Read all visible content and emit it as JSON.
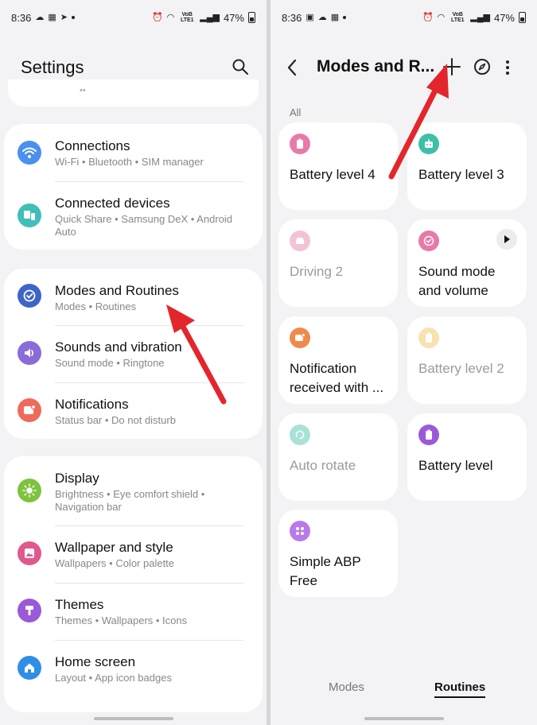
{
  "left": {
    "status": {
      "time": "8:36",
      "battery": "47%",
      "network": "VoB LTE1"
    },
    "title": "Settings",
    "groups": [
      {
        "items": [
          {
            "title": "Connections",
            "subtitle": "Wi-Fi  •  Bluetooth  •  SIM manager",
            "icon": "wifi-icon",
            "color": "#4a90f0"
          },
          {
            "title": "Connected devices",
            "subtitle": "Quick Share  •  Samsung DeX  •  Android Auto",
            "icon": "devices-icon",
            "color": "#3fbfb8"
          }
        ]
      },
      {
        "items": [
          {
            "title": "Modes and Routines",
            "subtitle": "Modes  •  Routines",
            "icon": "check-circle-icon",
            "color": "#3f64c8"
          },
          {
            "title": "Sounds and vibration",
            "subtitle": "Sound mode  •  Ringtone",
            "icon": "speaker-icon",
            "color": "#8a6cd8"
          },
          {
            "title": "Notifications",
            "subtitle": "Status bar  •  Do not disturb",
            "icon": "notification-icon",
            "color": "#ef6a5a"
          }
        ]
      },
      {
        "items": [
          {
            "title": "Display",
            "subtitle": "Brightness  •  Eye comfort shield  •  Navigation bar",
            "icon": "sun-icon",
            "color": "#7cc43c"
          },
          {
            "title": "Wallpaper and style",
            "subtitle": "Wallpapers  •  Color palette",
            "icon": "image-icon",
            "color": "#e0588e"
          },
          {
            "title": "Themes",
            "subtitle": "Themes  •  Wallpapers  •  Icons",
            "icon": "brush-icon",
            "color": "#9a5ad8"
          },
          {
            "title": "Home screen",
            "subtitle": "Layout  •  App icon badges",
            "icon": "home-icon",
            "color": "#2f8ee8"
          }
        ]
      }
    ]
  },
  "right": {
    "status": {
      "time": "8:36",
      "battery": "47%",
      "network": "VoB LTE1"
    },
    "title": "Modes and R...",
    "section_label": "All",
    "tiles": [
      {
        "label": "Battery level 4",
        "icon": "battery-icon",
        "color": "#e77aa8",
        "dim": false
      },
      {
        "label": "Battery level 3",
        "icon": "robot-icon",
        "color": "#3fbfa8",
        "dim": false
      },
      {
        "label": "Driving 2",
        "icon": "car-icon",
        "color": "#e77aa8",
        "dim": true
      },
      {
        "label": "Sound mode and volume",
        "icon": "check-circle-icon",
        "color": "#e77aa8",
        "dim": false,
        "play": true
      },
      {
        "label": "Notification received with ...",
        "icon": "message-icon",
        "color": "#f08a4a",
        "dim": false
      },
      {
        "label": "Battery level 2",
        "icon": "battery-icon",
        "color": "#f0c050",
        "dim": true
      },
      {
        "label": "Auto rotate",
        "icon": "rotate-icon",
        "color": "#3fbfa8",
        "dim": true
      },
      {
        "label": "Battery level",
        "icon": "battery-icon",
        "color": "#9a5ad8",
        "dim": false
      },
      {
        "label": "Simple ABP Free",
        "icon": "grid-icon",
        "color": "#b87ae8",
        "dim": false
      }
    ],
    "tabs": {
      "modes": "Modes",
      "routines": "Routines"
    }
  }
}
